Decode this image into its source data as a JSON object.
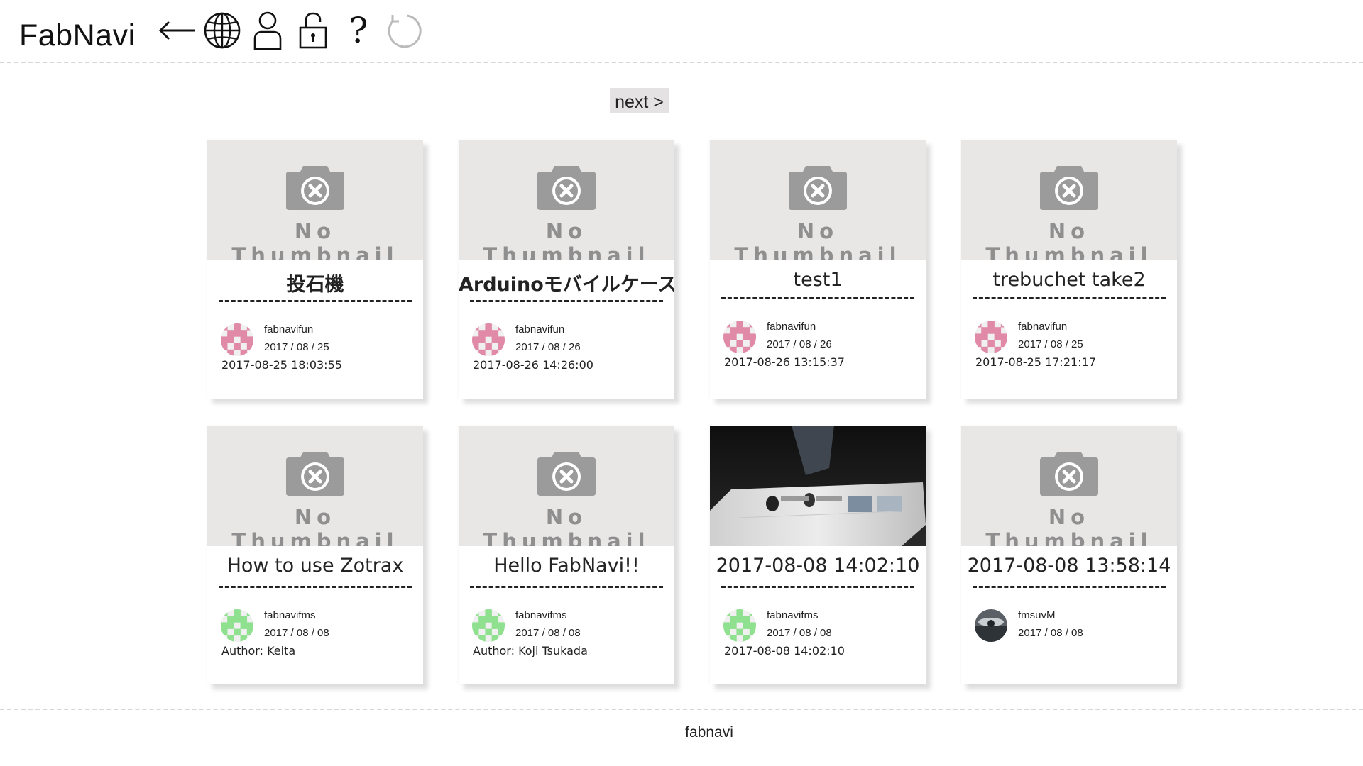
{
  "app": {
    "title": "FabNavi"
  },
  "toolbar": {
    "icons": [
      "back-arrow-icon",
      "globe-icon",
      "user-icon",
      "unlock-icon",
      "help-icon",
      "reload-icon"
    ],
    "help_label": "?"
  },
  "pager": {
    "next_label": "next >"
  },
  "thumbnail_placeholder": "No Thumbnail",
  "colors": {
    "thumb_bg": "#e9e6e6",
    "placeholder_gray": "#8f8f8f",
    "avatar_pink": "#e08aa8",
    "avatar_green": "#8fe08f",
    "pager_bg": "#e4e2e2"
  },
  "projects": [
    {
      "title": "投石機",
      "user": "fabnavifun",
      "date": "2017 / 08 / 25",
      "note": "2017-08-25 18:03:55",
      "avatar": "pink-identicon",
      "thumbnail": "none"
    },
    {
      "title": "Arduinoモバイルケース",
      "user": "fabnavifun",
      "date": "2017 / 08 / 26",
      "note": "2017-08-26 14:26:00",
      "avatar": "pink-identicon",
      "thumbnail": "none"
    },
    {
      "title": "test1",
      "user": "fabnavifun",
      "date": "2017 / 08 / 26",
      "note": "2017-08-26 13:15:37",
      "avatar": "pink-identicon",
      "thumbnail": "none"
    },
    {
      "title": "trebuchet take2",
      "user": "fabnavifun",
      "date": "2017 / 08 / 25",
      "note": "2017-08-25 17:21:17",
      "avatar": "pink-identicon",
      "thumbnail": "none"
    },
    {
      "title": "How to use Zotrax",
      "user": "fabnavifms",
      "date": "2017 / 08 / 08",
      "note": "Author: Keita",
      "avatar": "green-identicon",
      "thumbnail": "none"
    },
    {
      "title": "Hello FabNavi!!",
      "user": "fabnavifms",
      "date": "2017 / 08 / 08",
      "note": "Author: Koji Tsukada",
      "avatar": "green-identicon",
      "thumbnail": "none"
    },
    {
      "title": "2017-08-08 14:02:10",
      "user": "fabnavifms",
      "date": "2017 / 08 / 08",
      "note": "2017-08-08 14:02:10",
      "avatar": "green-identicon",
      "thumbnail": "photo"
    },
    {
      "title": "2017-08-08 13:58:14",
      "user": "fmsuvM",
      "date": "2017 / 08 / 08",
      "note": "",
      "avatar": "photo-avatar",
      "thumbnail": "none"
    }
  ],
  "footer": {
    "text": "fabnavi"
  }
}
